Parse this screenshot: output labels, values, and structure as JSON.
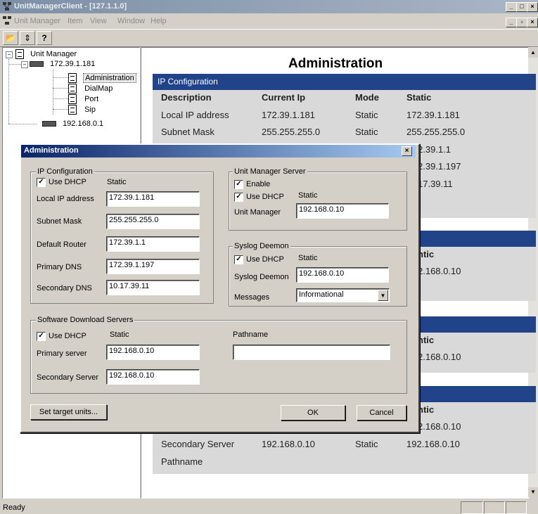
{
  "window": {
    "title": "UnitManagerClient - [127.1.1.0]",
    "minimize": "_",
    "maximize": "□",
    "close": "×",
    "mdi_minimize": "_",
    "mdi_restore": "▫",
    "mdi_close": "×"
  },
  "menu": [
    "Unit Manager",
    "Item",
    "View",
    "Window",
    "Help"
  ],
  "toolbar": {
    "open": "📂",
    "refresh": "⇕",
    "help": "?"
  },
  "tree": {
    "root": "Unit Manager",
    "host1": "172.39.1.181",
    "children": [
      "Administration",
      "DialMap",
      "Port",
      "Sip"
    ],
    "host2": "192.168.0.1",
    "expander_minus": "−"
  },
  "page": {
    "title": "Administration",
    "sections": [
      {
        "heading": "IP Configuration",
        "columns": [
          "Description",
          "Current Ip",
          "Mode",
          "Static"
        ],
        "rows": [
          [
            "Local IP address",
            "172.39.1.181",
            "Static",
            "172.39.1.181"
          ],
          [
            "Subnet Mask",
            "255.255.255.0",
            "Static",
            "255.255.255.0"
          ]
        ],
        "partial_static": [
          "2.39.1.1",
          "2.39.1.197",
          "17.39.11"
        ]
      },
      {
        "partial_head": "ntic",
        "partial_value": "2.168.0.10"
      },
      {
        "partial_head": "ntic",
        "partial_value": "2.168.0.10"
      },
      {
        "partial_head": "ntic",
        "partial_value": "2.168.0.10",
        "rows": [
          [
            "Secondary Server",
            "192.168.0.10",
            "Static",
            "192.168.0.10"
          ]
        ],
        "pathname": "Pathname"
      }
    ]
  },
  "status": {
    "text": "Ready"
  },
  "dialog": {
    "title": "Administration",
    "close": "×",
    "ip_config": {
      "group": "IP Configuration",
      "use_dhcp": "Use DHCP",
      "static": "Static",
      "check": "✓",
      "local_ip_label": "Local IP address",
      "local_ip": "172.39.1.181",
      "subnet_label": "Subnet Mask",
      "subnet": "255.255.255.0",
      "router_label": "Default Router",
      "router": "172.39.1.1",
      "pdns_label": "Primary DNS",
      "pdns": "172.39.1.197",
      "sdns_label": "Secondary DNS",
      "sdns": "10.17.39.11"
    },
    "unit_manager_server": {
      "group": "Unit Manager Server",
      "enable": "Enable",
      "use_dhcp": "Use DHCP",
      "static": "Static",
      "um_label": "Unit Manager",
      "um_value": "192.168.0.10"
    },
    "syslog": {
      "group": "Syslog Deemon",
      "use_dhcp": "Use DHCP",
      "static": "Static",
      "sd_label": "Syslog Deemon",
      "sd_value": "192.168.0.10",
      "msg_label": "Messages",
      "msg_value": "Informational",
      "arrow": "▼"
    },
    "software": {
      "group": "Software Download Servers",
      "use_dhcp": "Use DHCP",
      "static": "Static",
      "primary_label": "Primary server",
      "primary": "192.168.0.10",
      "secondary_label": "Secondary Server",
      "secondary": "192.168.0.10",
      "pathname_label": "Pathname",
      "pathname": ""
    },
    "buttons": {
      "set_target": "Set target units...",
      "ok": "OK",
      "cancel": "Cancel"
    }
  }
}
